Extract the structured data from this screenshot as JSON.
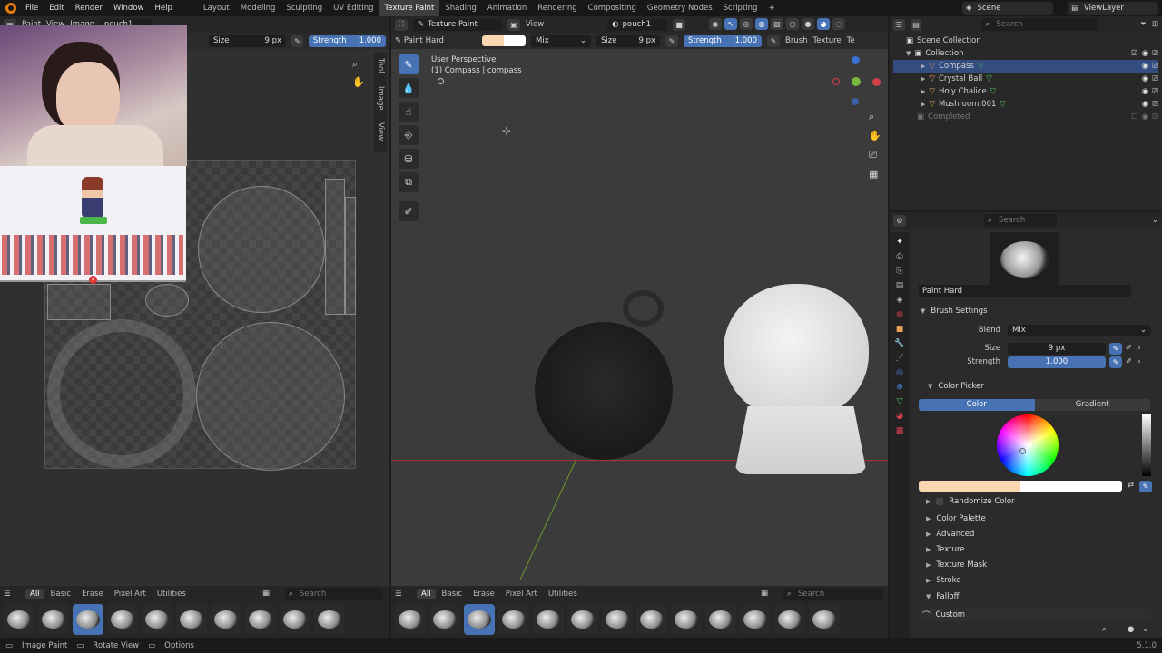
{
  "menu": [
    "File",
    "Edit",
    "Render",
    "Window",
    "Help"
  ],
  "workspaces": [
    "Layout",
    "Modeling",
    "Sculpting",
    "UV Editing",
    "Texture Paint",
    "Shading",
    "Animation",
    "Rendering",
    "Compositing",
    "Geometry Nodes",
    "Scripting"
  ],
  "active_workspace": "Texture Paint",
  "add_tab": "+",
  "scene": {
    "label": "Scene",
    "view_layer": "ViewLayer"
  },
  "image_editor": {
    "header_paint": "Paint",
    "header_view": "View",
    "header_image": "Image",
    "image_name": "pouch1",
    "size_label": "Size",
    "size_value": "9 px",
    "strength_label": "Strength",
    "strength_value": "1.000",
    "side_tabs": [
      "Tool",
      "Image",
      "View"
    ]
  },
  "viewport": {
    "mode": "Texture Paint",
    "view_menu": "View",
    "image_name": "pouch1",
    "brush_name": "Paint Hard",
    "blend": "Mix",
    "size_label": "Size",
    "size_value": "9 px",
    "strength_label": "Strength",
    "strength_value": "1.000",
    "brush_menu": "Brush",
    "texture_menu": "Texture",
    "overflow_tab": "Te",
    "perspective": "User Perspective",
    "object_info": "(1) Compass | compass"
  },
  "brush_tabs": [
    "All",
    "Basic",
    "Erase",
    "Pixel Art",
    "Utilities"
  ],
  "brush_search_placeholder": "Search",
  "outliner": {
    "search_placeholder": "Search",
    "root": "Scene Collection",
    "collection": "Collection",
    "items": [
      "Compass",
      "Crystal Ball",
      "Holy Chalice",
      "Mushroom.001"
    ],
    "completed": "Completed"
  },
  "properties": {
    "search_placeholder": "Search",
    "brush_name": "Paint Hard",
    "brush_settings": "Brush Settings",
    "blend_label": "Blend",
    "blend_value": "Mix",
    "size_label": "Size",
    "size_value": "9 px",
    "strength_label": "Strength",
    "strength_value": "1.000",
    "color_picker": "Color Picker",
    "color_tab": "Color",
    "gradient_tab": "Gradient",
    "randomize_color": "Randomize Color",
    "sections": [
      "Color Palette",
      "Advanced",
      "Texture",
      "Texture Mask",
      "Stroke",
      "Falloff"
    ],
    "falloff_preset": "Custom"
  },
  "status": {
    "left": "Image Paint",
    "middle": "Rotate View",
    "right": "Options",
    "version": "5.1.0"
  },
  "colors": {
    "accent": "#4772b3",
    "primary_color": "#fad7b0",
    "secondary_color": "#ffffff",
    "bg": "#303030"
  }
}
